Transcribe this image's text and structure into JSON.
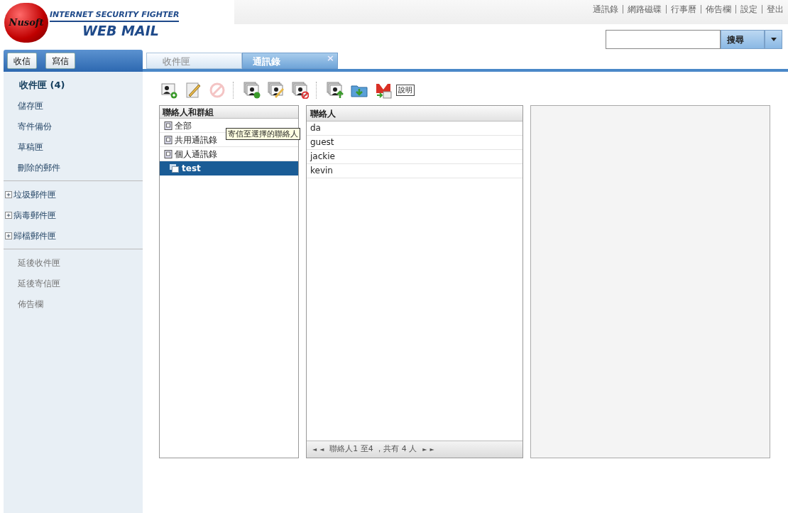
{
  "logo": {
    "brand": "Nusoft",
    "tagline": "INTERNET SECURITY FIGHTER",
    "product": "WEB MAIL"
  },
  "top_links": [
    "通訊錄",
    "網路磁碟",
    "行事曆",
    "佈告欄",
    "設定",
    "登出"
  ],
  "search": {
    "button": "搜尋"
  },
  "mail_buttons": [
    "收信",
    "寫信"
  ],
  "tabs": [
    {
      "label": "收件匣",
      "selected": false,
      "closable": false
    },
    {
      "label": "通訊錄",
      "selected": true,
      "closable": true
    }
  ],
  "close_glyph": "×",
  "sidebar": {
    "sections": [
      {
        "items": [
          {
            "label": "收件匣 (4)",
            "kind": "plain",
            "bold": true,
            "dim": false
          },
          {
            "label": "儲存匣",
            "kind": "plain",
            "bold": false,
            "dim": false
          },
          {
            "label": "寄件備份",
            "kind": "plain",
            "bold": false,
            "dim": false
          },
          {
            "label": "草稿匣",
            "kind": "plain",
            "bold": false,
            "dim": false
          },
          {
            "label": "刪除的郵件",
            "kind": "plain",
            "bold": false,
            "dim": false
          }
        ]
      },
      {
        "items": [
          {
            "label": "垃圾郵件匣",
            "kind": "expandable",
            "bold": false,
            "dim": false
          },
          {
            "label": "病毒郵件匣",
            "kind": "expandable",
            "bold": false,
            "dim": false
          },
          {
            "label": "歸檔郵件匣",
            "kind": "expandable",
            "bold": false,
            "dim": false
          }
        ]
      },
      {
        "items": [
          {
            "label": "延後收件匣",
            "kind": "plain",
            "bold": false,
            "dim": true
          },
          {
            "label": "延後寄信匣",
            "kind": "plain",
            "bold": false,
            "dim": true
          },
          {
            "label": "佈告欄",
            "kind": "plain",
            "bold": false,
            "dim": true
          }
        ]
      }
    ]
  },
  "toolbar": {
    "groups": [
      [
        {
          "kind": "contact-add",
          "disabled": false
        },
        {
          "kind": "edit",
          "disabled": false
        },
        {
          "kind": "stop",
          "disabled": true
        }
      ],
      [
        {
          "kind": "group-add",
          "disabled": false
        },
        {
          "kind": "group-edit",
          "disabled": false
        },
        {
          "kind": "group-delete",
          "disabled": false
        }
      ],
      [
        {
          "kind": "group-import",
          "disabled": false
        },
        {
          "kind": "folder-download",
          "disabled": false
        },
        {
          "kind": "mail-export",
          "disabled": false
        }
      ]
    ],
    "help": "說明"
  },
  "tooltip": "寄信至選擇的聯絡人",
  "groups_panel": {
    "header": "聯絡人和群組",
    "items": [
      {
        "label": "全部",
        "selected": false
      },
      {
        "label": "共用通訊錄",
        "selected": false
      },
      {
        "label": "個人通訊錄",
        "selected": false,
        "children": [
          {
            "label": "test",
            "selected": true
          }
        ]
      }
    ]
  },
  "contacts_panel": {
    "header": "聯絡人",
    "rows": [
      "da",
      "guest",
      "jackie",
      "kevin"
    ],
    "pager": {
      "first": "◄",
      "prev": "◄",
      "info": "聯絡人1 至4 ，共有 4 人",
      "next": "►",
      "last": "►"
    }
  }
}
